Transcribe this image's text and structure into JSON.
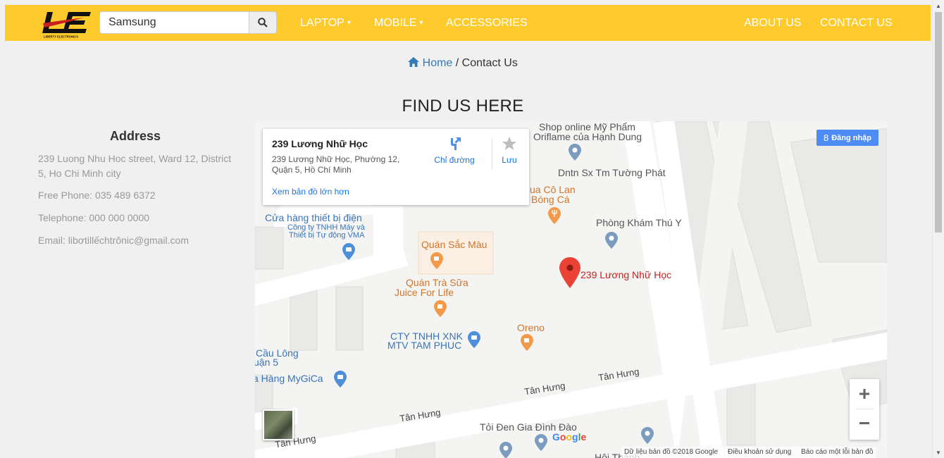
{
  "colors": {
    "navbar": "#ffca2c",
    "link": "#337ab7",
    "map_red": "#c5221f",
    "map_blue": "#3a73b8",
    "map_orange": "#d0752c"
  },
  "navbar": {
    "search_value": "Samsung",
    "links": {
      "laptop": "LAPTOP",
      "mobile": "MOBILE",
      "accessories": "ACCESSORIES",
      "about": "ABOUT US",
      "contact": "CONTACT US"
    },
    "caret": "▾"
  },
  "breadcrumb": {
    "home": "Home",
    "separator": " / ",
    "current": "Contact Us"
  },
  "page_title": "FIND US HERE",
  "address": {
    "title": "Address",
    "street": "239 Luong Nhu Hoc street, Ward 12, District 5, Ho Chi Minh city",
    "free_phone": "Free Phone: 035 489 6372",
    "telephone": "Telephone: 000 000 0000",
    "email": "Email: libơtillếchtrônic@gmail.com"
  },
  "map": {
    "card": {
      "title": "239 Lương Nhữ Học",
      "address": "239 Lương Nhữ Học, Phường 12, Quận 5, Hồ Chí Minh",
      "directions": "Chỉ đường",
      "save": "Lưu",
      "larger_map": "Xem bản đồ lớn hơn"
    },
    "login": "Đăng nhập",
    "pin_label": "239 Lương Nhữ Học",
    "places": {
      "shop_l1": "Shop online Mỹ Phẩm",
      "shop_l2": "Oriflame của Hạnh Dung",
      "dntn": "Dntn Sx Tm Tường Phát",
      "colan_l1": "ua Cô Lan",
      "colan_l2": "Bóng Cá",
      "phongkham": "Phòng Khám Thú Y",
      "cuahang": "Cửa hàng thiết bị điện",
      "cty_vma_l1": "Công ty TNHH Máy và",
      "cty_vma_l2": "Thiết bị Tự động VMA",
      "quan_sac_mau": "Quán Sắc Màu",
      "quan_tra_sua_l1": "Quán Trà Sữa",
      "quan_tra_sua_l2": "Juice For Life",
      "oreno": "Oreno",
      "cty_xnk_l1": "CTY TNHH XNK",
      "cty_xnk_l2": "MTV TAM PHUC",
      "cau_long_l1": "Cầu Lông",
      "cau_long_l2": "uận 5",
      "mygica": "a Hàng MyGiCa",
      "toi_den": "Tỏi Đen Gia Đình Đào",
      "hoi_thanh": "Hội Thánh"
    },
    "streets": [
      "Tân Hưng",
      "Tân Hưng",
      "Tân Hưng",
      "Tân Hưng"
    ],
    "zoom_in": "+",
    "zoom_out": "−",
    "google": [
      "G",
      "o",
      "o",
      "g",
      "l",
      "e"
    ],
    "attribution": {
      "data": "Dữ liệu bản đồ ©2018 Google",
      "terms": "Điều khoản sử dụng",
      "report": "Báo cáo một lỗi bản đồ"
    }
  },
  "icons": [
    "search-icon",
    "home-icon",
    "directions-icon",
    "star-icon",
    "map-pin-icon",
    "google-plus-icon"
  ]
}
